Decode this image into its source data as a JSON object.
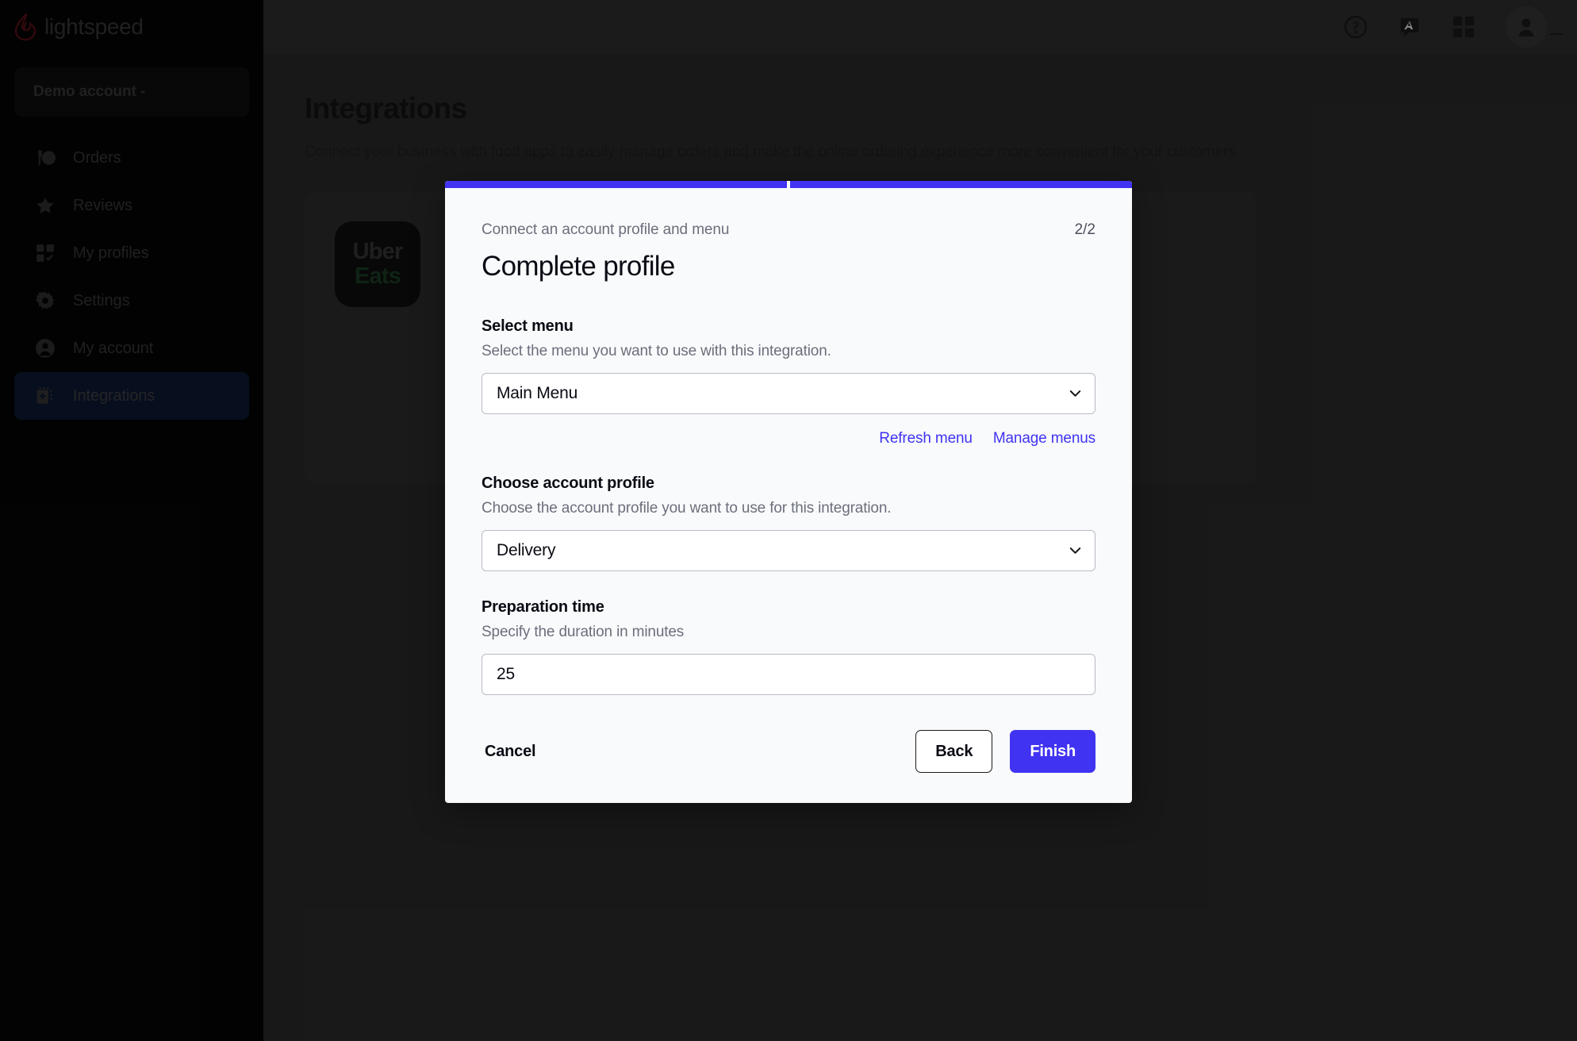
{
  "brand": {
    "name": "lightspeed",
    "flame_color": "#5c1118"
  },
  "sidebar": {
    "account": "Demo account -",
    "items": [
      {
        "label": "Orders",
        "icon": "orders-icon",
        "active": false
      },
      {
        "label": "Reviews",
        "icon": "star-icon",
        "active": false
      },
      {
        "label": "My profiles",
        "icon": "grid-check-icon",
        "active": false
      },
      {
        "label": "Settings",
        "icon": "gear-icon",
        "active": false
      },
      {
        "label": "My account",
        "icon": "user-circle-icon",
        "active": false
      },
      {
        "label": "Integrations",
        "icon": "integrations-icon",
        "active": true
      }
    ]
  },
  "topbar": {
    "icons": [
      "help-circle-icon",
      "announcement-icon",
      "apps-grid-icon",
      "user-avatar-icon"
    ]
  },
  "page": {
    "title": "Integrations",
    "subtitle": "Connect your business with food apps to easily manage orders and make the online ordering experience more convenient for your customers.",
    "integration_tile": {
      "line1": "Uber",
      "line2": "Eats",
      "line1_color": "#3a3a3a",
      "line2_color": "#1d4128"
    }
  },
  "modal": {
    "progress": {
      "total": 2,
      "completed": 2,
      "color": "#4033f2"
    },
    "eyebrow": "Connect an account profile and menu",
    "step": "2/2",
    "title": "Complete profile",
    "fields": [
      {
        "label": "Select menu",
        "help": "Select the menu you want to use with this integration.",
        "type": "select",
        "value": "Main Menu",
        "options": [
          "Main Menu"
        ]
      },
      {
        "label": "Choose account profile",
        "help": "Choose the account profile you want to use for this integration.",
        "type": "select",
        "value": "Delivery",
        "options": [
          "Delivery"
        ]
      },
      {
        "label": "Preparation time",
        "help": "Specify the duration in minutes",
        "type": "number",
        "value": "25",
        "placeholder": ""
      }
    ],
    "links": [
      {
        "label": "Refresh menu",
        "color": "#4033f2"
      },
      {
        "label": "Manage menus",
        "color": "#4033f2"
      }
    ],
    "buttons": {
      "cancel": "Cancel",
      "back": "Back",
      "finish": "Finish",
      "finish_color": "#4033f2"
    }
  }
}
